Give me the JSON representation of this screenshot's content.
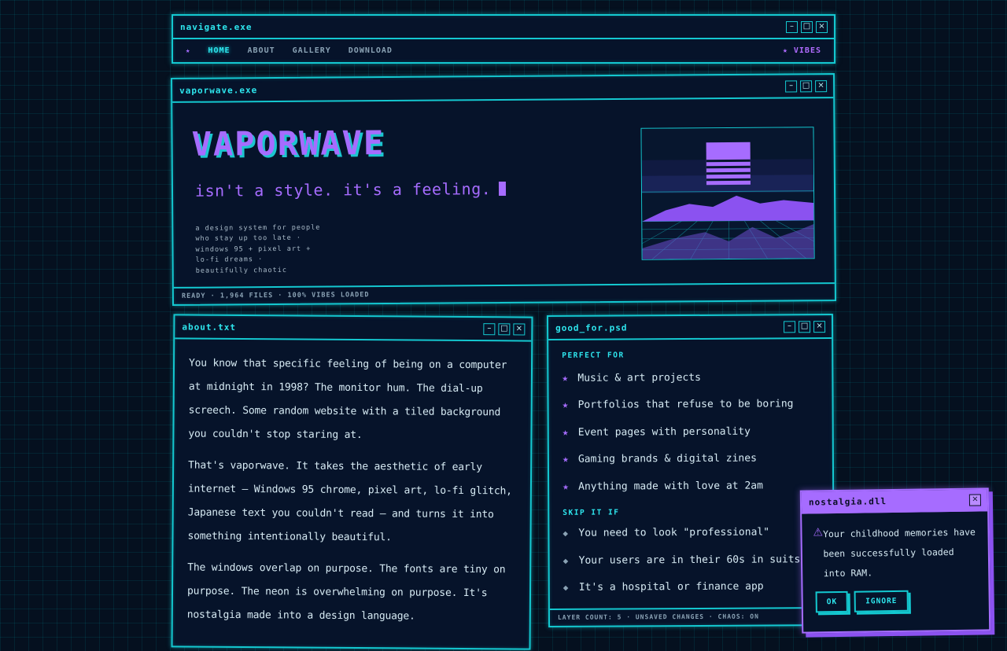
{
  "nav": {
    "title": "navigate.exe",
    "controls": [
      "–",
      "□",
      "×"
    ],
    "star": "★",
    "links": [
      "HOME",
      "ABOUT",
      "GALLERY",
      "DOWNLOAD"
    ],
    "active": "HOME",
    "vibes": "★ VIBES"
  },
  "hero": {
    "title": "vaporwave.exe",
    "heading": "VAPORWAVE",
    "subtitle": "isn't a style. it's a feeling.",
    "lines": [
      "a design system for people",
      "who stay up too late  ·",
      "windows 95 + pixel art +",
      "lo-fi dreams  ·",
      "beautifully chaotic"
    ],
    "status": "READY · 1,964 FILES · 100% VIBES LOADED"
  },
  "about": {
    "title": "about.txt",
    "paragraphs": [
      "You know that specific feeling of being on a computer at midnight in 1998? The monitor hum. The dial-up screech. Some random website with a tiled background you couldn't stop staring at.",
      "That's vaporwave. It takes the aesthetic of early internet — Windows 95 chrome, pixel art, lo-fi glitch, Japanese text you couldn't read — and turns it into something intentionally beautiful.",
      "The windows overlap on purpose. The fonts are tiny on purpose. The neon is overwhelming on purpose. It's nostalgia made into a design language."
    ]
  },
  "goodfor": {
    "title": "good_for.psd",
    "perfect_heading": "PERFECT FOR",
    "perfect_items": [
      "Music & art projects",
      "Portfolios that refuse to be boring",
      "Event pages with personality",
      "Gaming brands & digital zines",
      "Anything made with love at 2am"
    ],
    "skip_heading": "SKIP IT IF",
    "skip_items": [
      "You need to look \"professional\"",
      "Your users are in their 60s in suits",
      "It's a hospital or finance app"
    ],
    "status": "LAYER COUNT: 5 · UNSAVED CHANGES · CHAOS: ON",
    "star_icon": "★",
    "diamond_icon": "◆"
  },
  "nostalgia": {
    "title": "nostalgia.dll",
    "close": "×",
    "warning_icon": "⚠",
    "message": "Your childhood memories have been successfully loaded into RAM.",
    "ok": "OK",
    "ignore": "IGNORE"
  },
  "colors": {
    "cyan": "#14c8d0",
    "purple": "#a66cff",
    "background": "#05101f"
  }
}
